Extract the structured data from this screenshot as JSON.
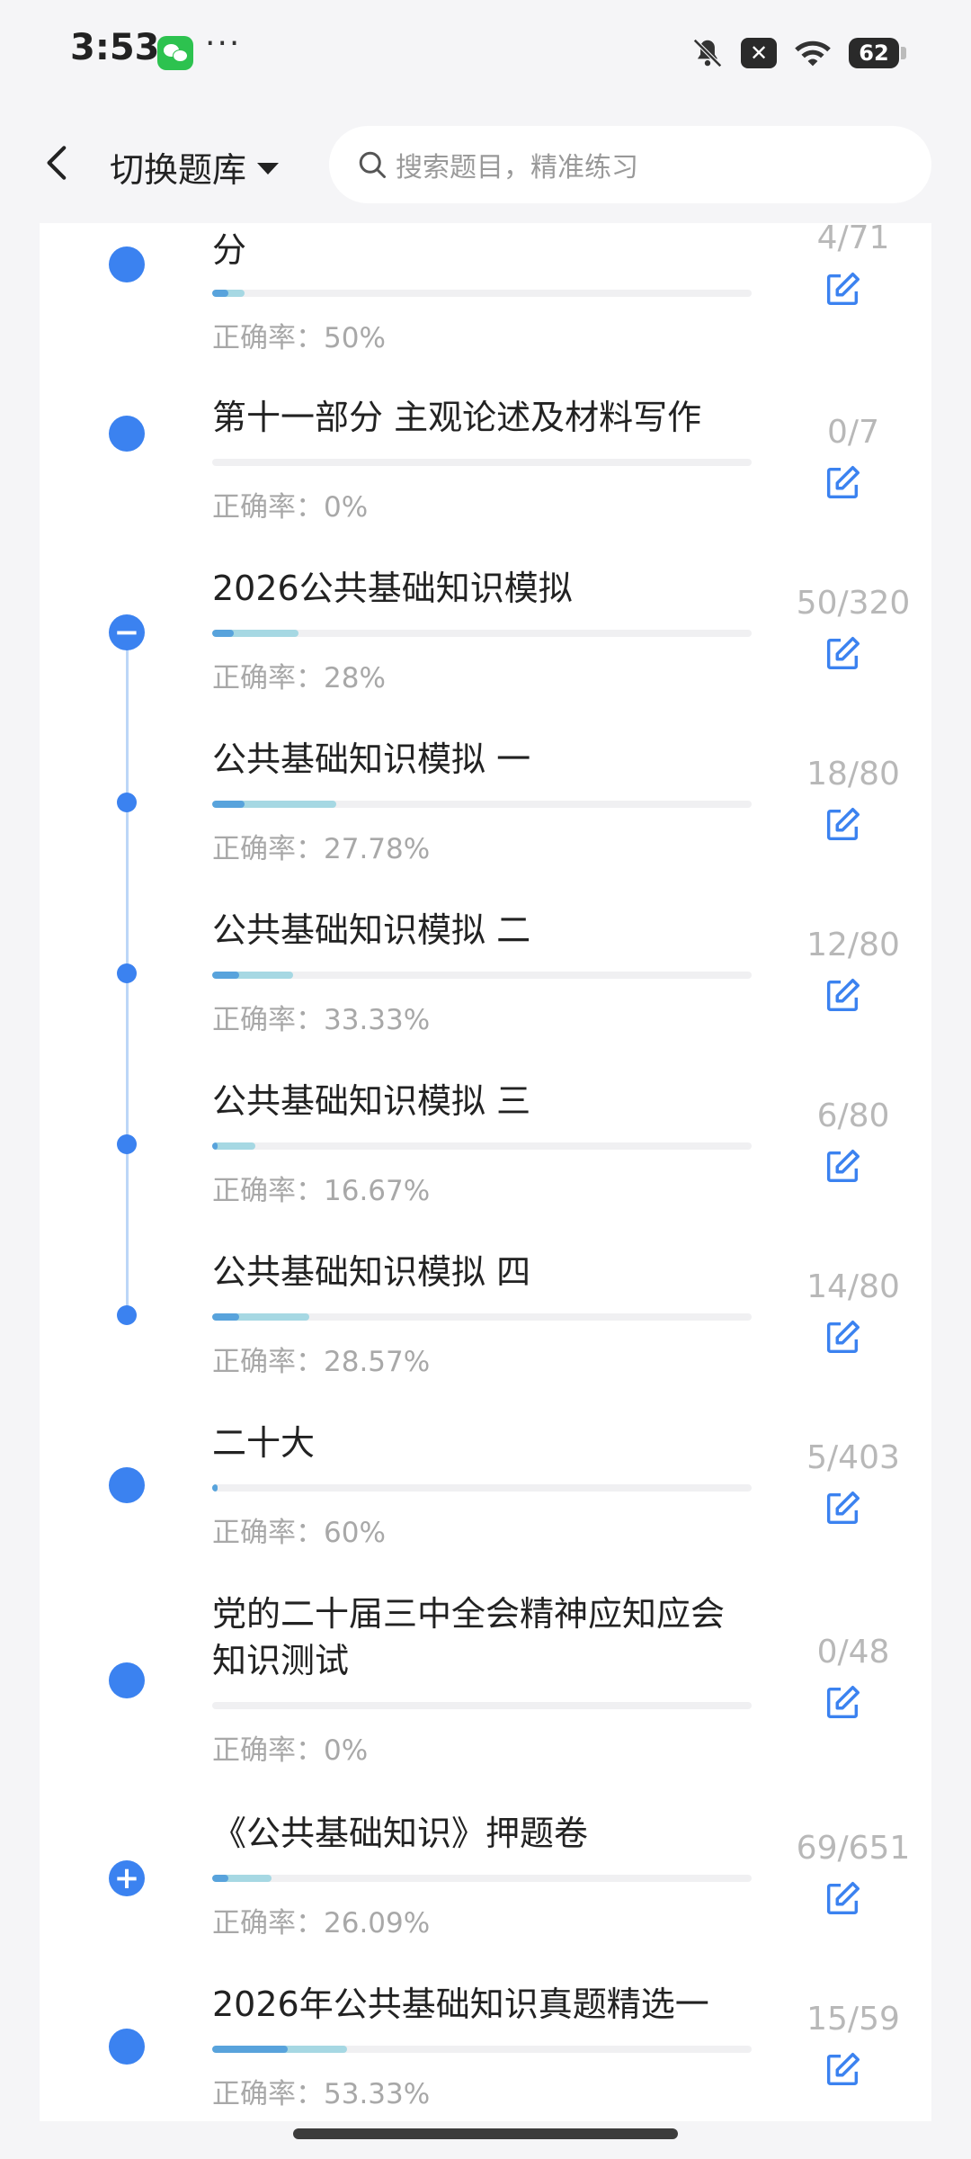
{
  "status": {
    "time": "3:53",
    "more": "···",
    "battery": "62",
    "x_badge": "✕"
  },
  "header": {
    "switch_label": "切换题库",
    "search_placeholder": "搜索题目，精准练习"
  },
  "items": [
    {
      "title": "分",
      "accuracy": "正确率：50%",
      "count": "4/71",
      "progress": 0.06
    },
    {
      "title": "第十一部分 主观论述及材料写作",
      "accuracy": "正确率：0%",
      "count": "0/7",
      "progress": 0.0
    },
    {
      "title": "2026公共基础知识模拟",
      "accuracy": "正确率：28%",
      "count": "50/320",
      "progress": 0.16,
      "expanded": true
    },
    {
      "title": "公共基础知识模拟 一",
      "accuracy": "正确率：27.78%",
      "count": "18/80",
      "progress": 0.23
    },
    {
      "title": "公共基础知识模拟 二",
      "accuracy": "正确率：33.33%",
      "count": "12/80",
      "progress": 0.15
    },
    {
      "title": "公共基础知识模拟 三",
      "accuracy": "正确率：16.67%",
      "count": "6/80",
      "progress": 0.08
    },
    {
      "title": "公共基础知识模拟 四",
      "accuracy": "正确率：28.57%",
      "count": "14/80",
      "progress": 0.18
    },
    {
      "title": "二十大",
      "accuracy": "正确率：60%",
      "count": "5/403",
      "progress": 0.01
    },
    {
      "title": "党的二十届三中全会精神应知应会知识测试",
      "accuracy": "正确率：0%",
      "count": "0/48",
      "progress": 0.0
    },
    {
      "title": "《公共基础知识》押题卷",
      "accuracy": "正确率：26.09%",
      "count": "69/651",
      "progress": 0.11,
      "collapsed": true
    },
    {
      "title": "2026年公共基础知识真题精选一",
      "accuracy": "正确率：53.33%",
      "count": "15/59",
      "progress": 0.25
    }
  ],
  "colors": {
    "accent": "#3b82f0",
    "bar_fill": "#58a3dc",
    "bar_light": "#a6d8e3"
  }
}
